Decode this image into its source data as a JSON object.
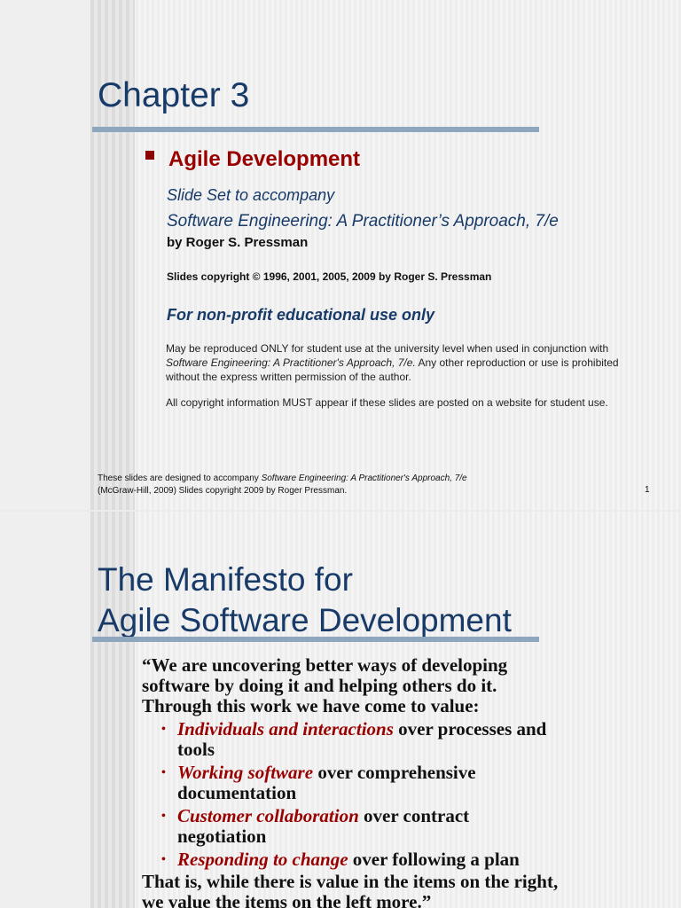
{
  "slide1": {
    "title": "Chapter 3",
    "bullet": "Agile Development",
    "subtitle1": "Slide Set to accompany",
    "subtitle2": "Software Engineering: A Practitioner’s Approach, 7/e",
    "author": "by Roger S. Pressman",
    "copyright": "Slides copyright © 1996, 2001, 2005, 2009  by Roger S. Pressman",
    "nonprofit": "For non-profit educational use only",
    "para1_a": "May be reproduced ONLY for student use at the university level when used in conjunction with ",
    "para1_italic": "Software Engineering: A Practitioner's Approach, 7/e.",
    "para1_b": " Any other reproduction or use is prohibited without the express written permission of the author.",
    "para2": "All copyright information MUST appear if these slides are posted on a website for student use.",
    "footer_a": "These slides are designed to accompany ",
    "footer_italic": "Software Engineering: A Practitioner's Approach, 7/e",
    "footer_b": "(McGraw-Hill, 2009) Slides copyright 2009 by Roger Pressman.",
    "page": "1"
  },
  "slide2": {
    "title_line1": "The Manifesto for",
    "title_line2": "Agile Software Development",
    "intro": "“We are uncovering better ways of developing software by doing it and helping others do it. Through this work we have come to value:",
    "items": [
      {
        "em": "Individuals and interactions",
        "rest": " over processes and tools"
      },
      {
        "em": "Working software",
        "rest": " over comprehensive documentation"
      },
      {
        "em": "Customer collaboration",
        "rest": " over contract negotiation"
      },
      {
        "em": "Responding to change",
        "rest": " over following a plan"
      }
    ],
    "outro": "That is, while there is value in the items on the right, we value the items on the left more.”"
  }
}
